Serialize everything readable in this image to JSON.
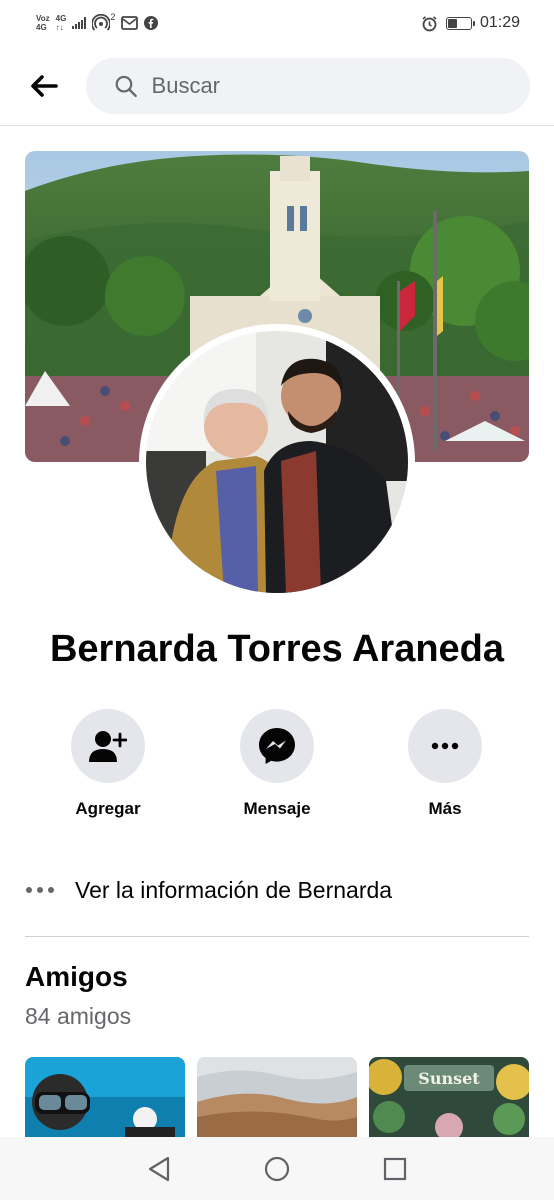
{
  "status_bar": {
    "carrier_top": "Voz",
    "carrier_bottom": "4G",
    "network_type": "4G",
    "hotspot_count": "2",
    "time": "01:29",
    "icons": [
      "signal-icon",
      "hotspot-icon",
      "mail-icon",
      "facebook-icon",
      "alarm-icon",
      "battery-icon"
    ]
  },
  "search": {
    "placeholder": "Buscar"
  },
  "profile": {
    "name": "Bernarda Torres Araneda"
  },
  "actions": [
    {
      "label": "Agregar",
      "icon": "add-friend-icon"
    },
    {
      "label": "Mensaje",
      "icon": "messenger-icon"
    },
    {
      "label": "Más",
      "icon": "more-icon"
    }
  ],
  "info": {
    "label": "Ver la información de Bernarda"
  },
  "friends": {
    "title": "Amigos",
    "count": "84 amigos",
    "thumb_texts": [
      "Sunset"
    ]
  },
  "colors": {
    "accent": "#050505",
    "button_bg": "#e4e6eb",
    "search_bg": "#f0f2f5",
    "secondary_text": "#65676b",
    "divider": "#ced0d4"
  }
}
